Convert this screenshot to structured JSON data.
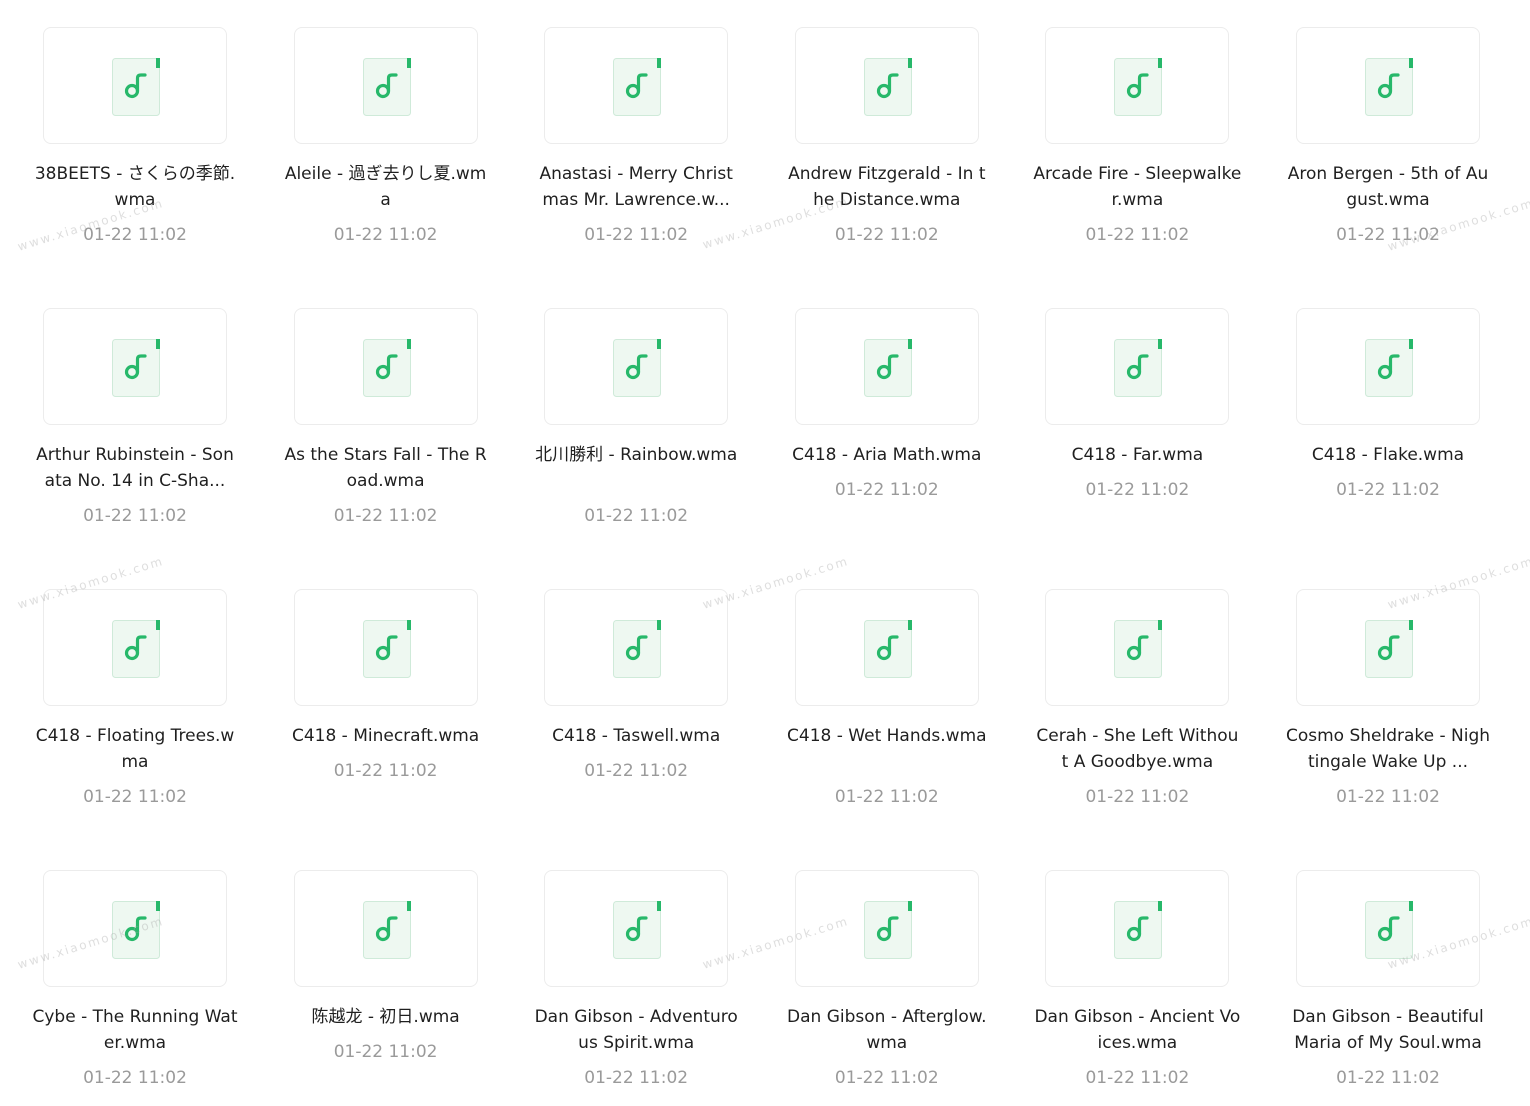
{
  "watermark_text": "www.xiaomook.com",
  "icon": {
    "name": "music-file-icon",
    "page_color": "#eef8f1",
    "page_border": "#cfead9",
    "accent": "#27b86a"
  },
  "files": [
    {
      "name": "38BEETS - さくらの季節.wma",
      "date": "01-22 11:02",
      "lines": 2
    },
    {
      "name": "Aleile - 過ぎ去りし夏.wma",
      "date": "01-22 11:02",
      "lines": 2
    },
    {
      "name": "Anastasi - Merry Christmas Mr. Lawrence.w...",
      "date": "01-22 11:02",
      "lines": 2
    },
    {
      "name": "Andrew Fitzgerald - In the Distance.wma",
      "date": "01-22 11:02",
      "lines": 2
    },
    {
      "name": "Arcade Fire - Sleepwalker.wma",
      "date": "01-22 11:02",
      "lines": 2
    },
    {
      "name": "Aron Bergen - 5th of August.wma",
      "date": "01-22 11:02",
      "lines": 2
    },
    {
      "name": "Arthur Rubinstein - Sonata No. 14 in C-Sha...",
      "date": "01-22 11:02",
      "lines": 2
    },
    {
      "name": "As the Stars Fall - The Road.wma",
      "date": "01-22 11:02",
      "lines": 2
    },
    {
      "name": "北川勝利 - Rainbow.wma",
      "date": "01-22 11:02",
      "lines": 2
    },
    {
      "name": "C418 - Aria Math.wma",
      "date": "01-22 11:02",
      "lines": 1
    },
    {
      "name": "C418 - Far.wma",
      "date": "01-22 11:02",
      "lines": 1
    },
    {
      "name": "C418 - Flake.wma",
      "date": "01-22 11:02",
      "lines": 1
    },
    {
      "name": "C418 - Floating Trees.wma",
      "date": "01-22 11:02",
      "lines": 2
    },
    {
      "name": "C418 - Minecraft.wma",
      "date": "01-22 11:02",
      "lines": 1
    },
    {
      "name": "C418 - Taswell.wma",
      "date": "01-22 11:02",
      "lines": 1
    },
    {
      "name": "C418 - Wet Hands.wma",
      "date": "01-22 11:02",
      "lines": 2
    },
    {
      "name": "Cerah - She Left Without A Goodbye.wma",
      "date": "01-22 11:02",
      "lines": 2
    },
    {
      "name": "Cosmo Sheldrake - Nightingale Wake Up ...",
      "date": "01-22 11:02",
      "lines": 2
    },
    {
      "name": "Cybe - The Running Water.wma",
      "date": "01-22 11:02",
      "lines": 2
    },
    {
      "name": "陈越龙 - 初日.wma",
      "date": "01-22 11:02",
      "lines": 1
    },
    {
      "name": "Dan Gibson - Adventurous Spirit.wma",
      "date": "01-22 11:02",
      "lines": 2
    },
    {
      "name": "Dan Gibson - Afterglow.wma",
      "date": "01-22 11:02",
      "lines": 2
    },
    {
      "name": "Dan Gibson - Ancient Voices.wma",
      "date": "01-22 11:02",
      "lines": 2
    },
    {
      "name": "Dan Gibson - Beautiful Maria of My Soul.wma",
      "date": "01-22 11:02",
      "lines": 2
    }
  ]
}
